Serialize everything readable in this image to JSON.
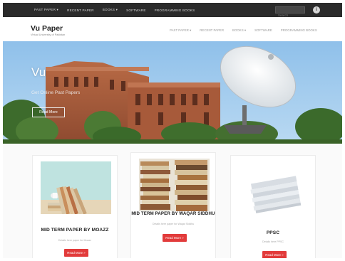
{
  "topbar": {
    "menu": [
      "PAST PAPER ▾",
      "RECENT PAPER",
      "BOOKS ▾",
      "SOFTWARE",
      "PROGRAMMING BOOKS"
    ],
    "search_placeholder": "Search",
    "social_icon": "info-icon"
  },
  "header": {
    "title": "Vu Paper",
    "tagline": "Virtual University of Pakistan",
    "nav": [
      "PAST PAPER ▾",
      "RECENT PAPER",
      "BOOKS ▾",
      "SOFTWARE",
      "PROGRAMMING BOOKS"
    ]
  },
  "hero": {
    "title": "Vu",
    "subtitle": "Get Online Past Papers",
    "button": "Read More"
  },
  "cards": [
    {
      "title": "MID TERM PAPER BY MOAZZ",
      "desc": "Details here paper for Moazz",
      "button": "Read More »"
    },
    {
      "title": "MID TERM PAPER BY WAQAR SIDDHU",
      "desc": "Details here paper for Waqar Siddhu",
      "button": "Read More »"
    },
    {
      "title": "PPSC",
      "desc": "Details here PPSC",
      "button": "Read More »"
    }
  ],
  "colors": {
    "topbar": "#2b2b2b",
    "accent_red": "#e23b3b",
    "sky": "#9cc7ea",
    "brick": "#a4593a"
  }
}
